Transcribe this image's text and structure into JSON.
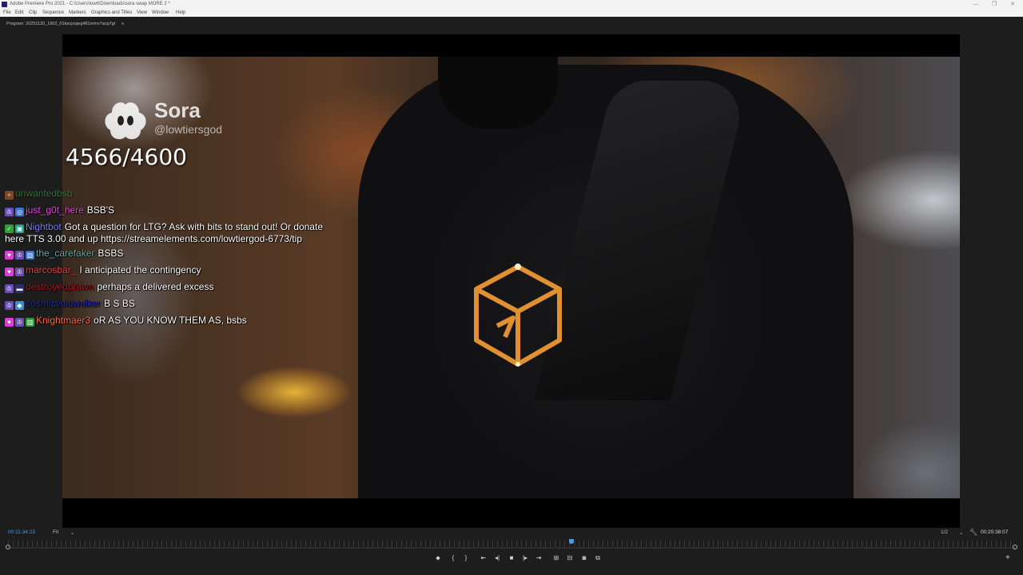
{
  "window": {
    "title": "Adobe Premiere Pro 2021 - C:\\Users\\lowtl\\Downloads\\sora swap MORE 2 *",
    "buttons": [
      "—",
      "❐",
      "✕"
    ]
  },
  "menu": [
    "File",
    "Edit",
    "Clip",
    "Sequence",
    "Markers",
    "Graphics and Titles",
    "View",
    "Window",
    "Help"
  ],
  "panel": {
    "title": "Program: 20251120_1902_01kacjxsjeg481ermv7acp7gt",
    "menu_icon": "≡"
  },
  "video": {
    "watermark": {
      "name": "Sora",
      "handle": "@lowtiersgod"
    },
    "counter": "4566/4600",
    "chat": [
      {
        "badges": [
          {
            "icon": "mod-icon",
            "color": "#d0692a"
          }
        ],
        "user": "unwantedbsb",
        "user_color": "#4caf50",
        "text": ""
      },
      {
        "badges": [
          {
            "icon": "prime-icon",
            "color": "#6a4fb3"
          },
          {
            "icon": "controller-icon",
            "color": "#3a73c8"
          }
        ],
        "user": "just_g0t_here",
        "user_color": "#e04bd5",
        "text": "BSB'S"
      },
      {
        "badges": [
          {
            "icon": "check-icon",
            "color": "#2e9e3a"
          },
          {
            "icon": "bot-icon",
            "color": "#1f9e88"
          }
        ],
        "user": "Nightbot",
        "user_color": "#7c7cff",
        "text": "Got a question for LTG? Ask with bits to stand out! Or donate here TTS 3.00 and up https://streamelements.com/lowtiergod-6773/tip"
      },
      {
        "badges": [
          {
            "icon": "heart-icon",
            "color": "#d63fd6"
          },
          {
            "icon": "prime-icon",
            "color": "#6a4fb3"
          },
          {
            "icon": "gift-icon",
            "color": "#3a73c8"
          }
        ],
        "user": "the_carefaker",
        "user_color": "#5fb0a8",
        "text": "BSBS"
      },
      {
        "badges": [
          {
            "icon": "heart-icon",
            "color": "#d63fd6"
          },
          {
            "icon": "prime-icon",
            "color": "#6a4fb3"
          }
        ],
        "user": "marcosbar_",
        "user_color": "#e24444",
        "text": "I anticipated the contingency"
      },
      {
        "badges": [
          {
            "icon": "prime-icon",
            "color": "#6a4fb3"
          },
          {
            "icon": "dash-icon",
            "color": "#2b2f6b"
          }
        ],
        "user": "destroyedprawn",
        "user_color": "#b0171a",
        "text": "perhaps a delivered excess"
      },
      {
        "badges": [
          {
            "icon": "prime-icon",
            "color": "#6a4fb3"
          },
          {
            "icon": "sub-icon",
            "color": "#3a8fd6"
          }
        ],
        "user": "cosmicvoidwalker",
        "user_color": "#1c2fa8",
        "text": "B S BS"
      },
      {
        "badges": [
          {
            "icon": "heart-icon",
            "color": "#d63fd6"
          },
          {
            "icon": "prime-icon",
            "color": "#6a4fb3"
          },
          {
            "icon": "gift-icon",
            "color": "#2e9e3a"
          }
        ],
        "user": "Knightmaer3",
        "user_color": "#ff6a3d",
        "text": "oR AS YOU KNOW THEM AS, bsbs"
      }
    ]
  },
  "transport": {
    "timecode_current": "00:11:34:23",
    "fit_label": "Fit",
    "resolution": "1/2",
    "timecode_total": "00:20:38:07",
    "dropdown_arrow": "⌄",
    "controls": [
      "⬥",
      "{",
      "}",
      "⇤",
      "◂|",
      "■",
      "|▸",
      "⇥",
      "⊞",
      "⊟",
      "◙",
      "⧉"
    ],
    "add_label": "+"
  }
}
